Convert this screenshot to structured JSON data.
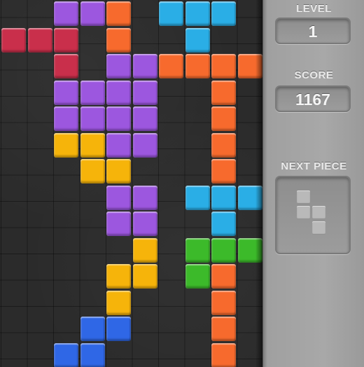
{
  "colors": {
    "purple": "#9c57df",
    "orange": "#f76a2d",
    "cyan": "#2aaee6",
    "red": "#c92f4b",
    "yellow": "#f6b40a",
    "blue": "#2f67e6",
    "green": "#3cba2a"
  },
  "board": {
    "blocks": [
      {
        "col": 2,
        "row": 0,
        "color": "purple"
      },
      {
        "col": 3,
        "row": 0,
        "color": "purple"
      },
      {
        "col": 4,
        "row": 0,
        "color": "orange"
      },
      {
        "col": 6,
        "row": 0,
        "color": "cyan"
      },
      {
        "col": 7,
        "row": 0,
        "color": "cyan"
      },
      {
        "col": 8,
        "row": 0,
        "color": "cyan"
      },
      {
        "col": 0,
        "row": 1,
        "color": "red"
      },
      {
        "col": 1,
        "row": 1,
        "color": "red"
      },
      {
        "col": 2,
        "row": 1,
        "color": "red"
      },
      {
        "col": 4,
        "row": 1,
        "color": "orange"
      },
      {
        "col": 7,
        "row": 1,
        "color": "cyan"
      },
      {
        "col": 2,
        "row": 2,
        "color": "red"
      },
      {
        "col": 4,
        "row": 2,
        "color": "purple"
      },
      {
        "col": 5,
        "row": 2,
        "color": "purple"
      },
      {
        "col": 6,
        "row": 2,
        "color": "orange"
      },
      {
        "col": 7,
        "row": 2,
        "color": "orange"
      },
      {
        "col": 8,
        "row": 2,
        "color": "orange"
      },
      {
        "col": 9,
        "row": 2,
        "color": "orange"
      },
      {
        "col": 2,
        "row": 3,
        "color": "purple"
      },
      {
        "col": 3,
        "row": 3,
        "color": "purple"
      },
      {
        "col": 4,
        "row": 3,
        "color": "purple"
      },
      {
        "col": 5,
        "row": 3,
        "color": "purple"
      },
      {
        "col": 8,
        "row": 3,
        "color": "orange"
      },
      {
        "col": 2,
        "row": 4,
        "color": "purple"
      },
      {
        "col": 3,
        "row": 4,
        "color": "purple"
      },
      {
        "col": 4,
        "row": 4,
        "color": "purple"
      },
      {
        "col": 5,
        "row": 4,
        "color": "purple"
      },
      {
        "col": 8,
        "row": 4,
        "color": "orange"
      },
      {
        "col": 2,
        "row": 5,
        "color": "yellow"
      },
      {
        "col": 3,
        "row": 5,
        "color": "yellow"
      },
      {
        "col": 4,
        "row": 5,
        "color": "purple"
      },
      {
        "col": 5,
        "row": 5,
        "color": "purple"
      },
      {
        "col": 8,
        "row": 5,
        "color": "orange"
      },
      {
        "col": 3,
        "row": 6,
        "color": "yellow"
      },
      {
        "col": 4,
        "row": 6,
        "color": "yellow"
      },
      {
        "col": 8,
        "row": 6,
        "color": "orange"
      },
      {
        "col": 4,
        "row": 7,
        "color": "purple"
      },
      {
        "col": 5,
        "row": 7,
        "color": "purple"
      },
      {
        "col": 7,
        "row": 7,
        "color": "cyan"
      },
      {
        "col": 8,
        "row": 7,
        "color": "cyan"
      },
      {
        "col": 9,
        "row": 7,
        "color": "cyan"
      },
      {
        "col": 4,
        "row": 8,
        "color": "purple"
      },
      {
        "col": 5,
        "row": 8,
        "color": "purple"
      },
      {
        "col": 8,
        "row": 8,
        "color": "cyan"
      },
      {
        "col": 5,
        "row": 9,
        "color": "yellow"
      },
      {
        "col": 7,
        "row": 9,
        "color": "green"
      },
      {
        "col": 8,
        "row": 9,
        "color": "green"
      },
      {
        "col": 9,
        "row": 9,
        "color": "green"
      },
      {
        "col": 4,
        "row": 10,
        "color": "yellow"
      },
      {
        "col": 5,
        "row": 10,
        "color": "yellow"
      },
      {
        "col": 7,
        "row": 10,
        "color": "green"
      },
      {
        "col": 8,
        "row": 10,
        "color": "orange"
      },
      {
        "col": 4,
        "row": 11,
        "color": "yellow"
      },
      {
        "col": 8,
        "row": 11,
        "color": "orange"
      },
      {
        "col": 3,
        "row": 12,
        "color": "blue"
      },
      {
        "col": 4,
        "row": 12,
        "color": "blue"
      },
      {
        "col": 8,
        "row": 12,
        "color": "orange"
      },
      {
        "col": 2,
        "row": 13,
        "color": "blue"
      },
      {
        "col": 3,
        "row": 13,
        "color": "blue"
      },
      {
        "col": 8,
        "row": 13,
        "color": "orange"
      }
    ]
  },
  "sidebar": {
    "level_label": "LEVEL",
    "level_value": "1",
    "score_label": "SCORE",
    "score_value": "1167",
    "next_piece_label": "NEXT PIECE",
    "next_piece": {
      "shape": "S",
      "color": "#b9b9b9",
      "cells": [
        {
          "col": 0,
          "row": 0
        },
        {
          "col": 0,
          "row": 1
        },
        {
          "col": 1,
          "row": 1
        },
        {
          "col": 1,
          "row": 2
        }
      ]
    }
  }
}
